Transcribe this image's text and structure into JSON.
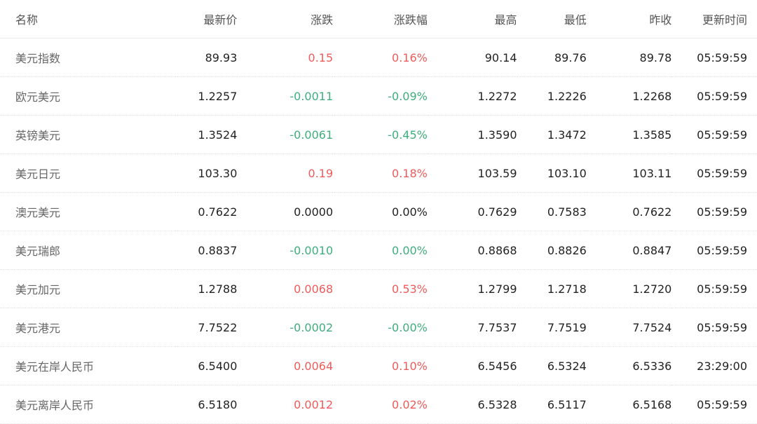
{
  "table": {
    "headers": {
      "name": "名称",
      "last": "最新价",
      "change": "涨跌",
      "change_pct": "涨跌幅",
      "high": "最高",
      "low": "最低",
      "prev_close": "昨收",
      "updated": "更新时间"
    },
    "rows": [
      {
        "name": "美元指数",
        "last": "89.93",
        "change": "0.15",
        "change_pct": "0.16%",
        "high": "90.14",
        "low": "89.76",
        "prev_close": "89.78",
        "updated": "05:59:59",
        "change_dir": "up",
        "pct_dir": "up"
      },
      {
        "name": "欧元美元",
        "last": "1.2257",
        "change": "-0.0011",
        "change_pct": "-0.09%",
        "high": "1.2272",
        "low": "1.2226",
        "prev_close": "1.2268",
        "updated": "05:59:59",
        "change_dir": "down",
        "pct_dir": "down"
      },
      {
        "name": "英镑美元",
        "last": "1.3524",
        "change": "-0.0061",
        "change_pct": "-0.45%",
        "high": "1.3590",
        "low": "1.3472",
        "prev_close": "1.3585",
        "updated": "05:59:59",
        "change_dir": "down",
        "pct_dir": "down"
      },
      {
        "name": "美元日元",
        "last": "103.30",
        "change": "0.19",
        "change_pct": "0.18%",
        "high": "103.59",
        "low": "103.10",
        "prev_close": "103.11",
        "updated": "05:59:59",
        "change_dir": "up",
        "pct_dir": "up"
      },
      {
        "name": "澳元美元",
        "last": "0.7622",
        "change": "0.0000",
        "change_pct": "0.00%",
        "high": "0.7629",
        "low": "0.7583",
        "prev_close": "0.7622",
        "updated": "05:59:59",
        "change_dir": "flat",
        "pct_dir": "flat"
      },
      {
        "name": "美元瑞郎",
        "last": "0.8837",
        "change": "-0.0010",
        "change_pct": "0.00%",
        "high": "0.8868",
        "low": "0.8826",
        "prev_close": "0.8847",
        "updated": "05:59:59",
        "change_dir": "down",
        "pct_dir": "down"
      },
      {
        "name": "美元加元",
        "last": "1.2788",
        "change": "0.0068",
        "change_pct": "0.53%",
        "high": "1.2799",
        "low": "1.2718",
        "prev_close": "1.2720",
        "updated": "05:59:59",
        "change_dir": "up",
        "pct_dir": "up"
      },
      {
        "name": "美元港元",
        "last": "7.7522",
        "change": "-0.0002",
        "change_pct": "-0.00%",
        "high": "7.7537",
        "low": "7.7519",
        "prev_close": "7.7524",
        "updated": "05:59:59",
        "change_dir": "down",
        "pct_dir": "down"
      },
      {
        "name": "美元在岸人民币",
        "last": "6.5400",
        "change": "0.0064",
        "change_pct": "0.10%",
        "high": "6.5456",
        "low": "6.5324",
        "prev_close": "6.5336",
        "updated": "23:29:00",
        "change_dir": "up",
        "pct_dir": "up"
      },
      {
        "name": "美元离岸人民币",
        "last": "6.5180",
        "change": "0.0012",
        "change_pct": "0.02%",
        "high": "6.5328",
        "low": "6.5117",
        "prev_close": "6.5168",
        "updated": "05:59:59",
        "change_dir": "up",
        "pct_dir": "up"
      }
    ]
  },
  "colors": {
    "up": "#f05b5b",
    "down": "#3fae7c",
    "flat": "#222222",
    "header_text": "#555555",
    "name_text": "#666666"
  }
}
